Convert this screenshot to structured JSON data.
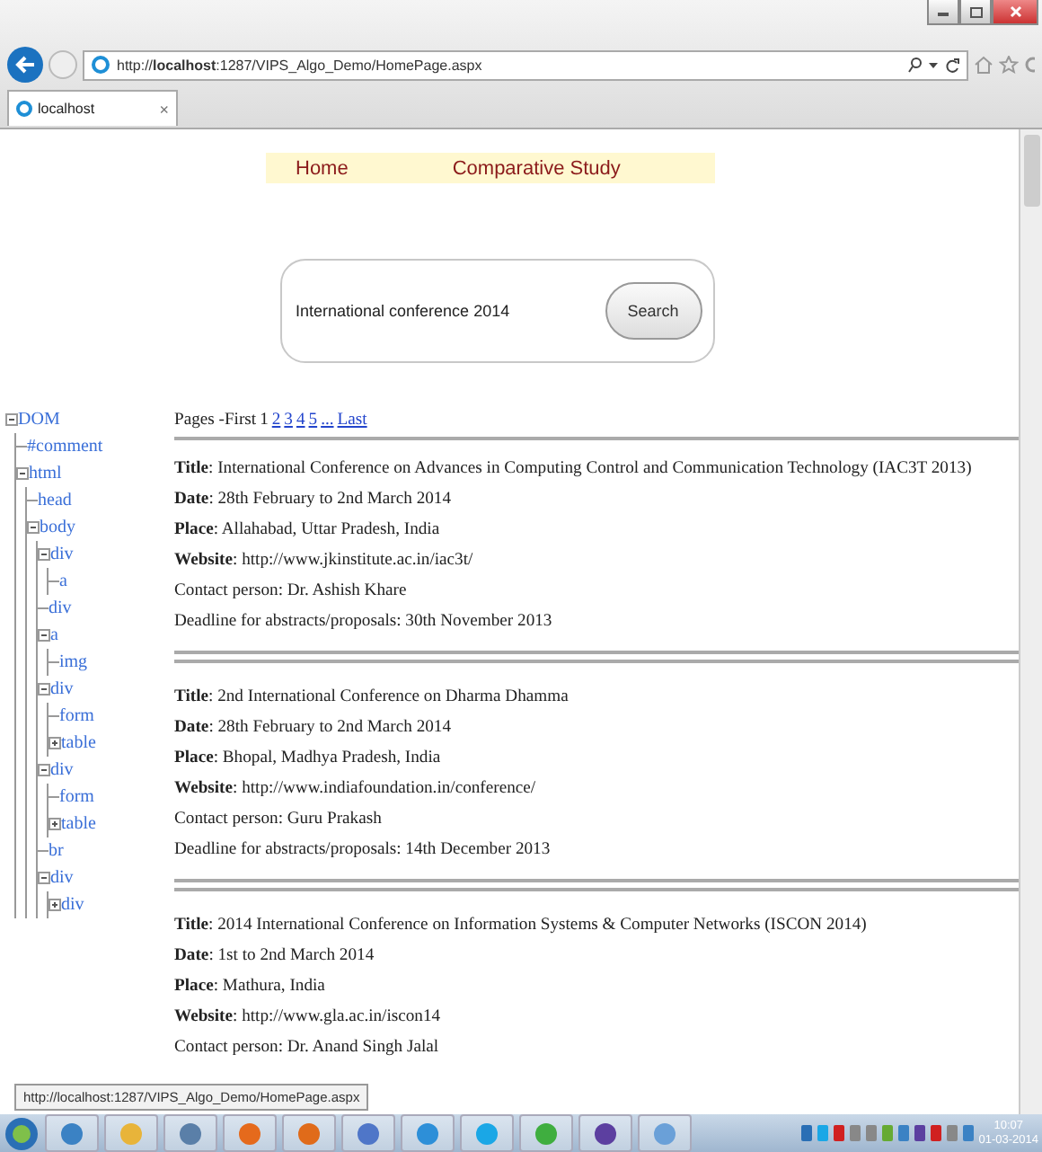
{
  "browser": {
    "address": "http://**localhost**:1287/VIPS_Algo_Demo/HomePage.aspx",
    "tabs": [
      {
        "label": "localhost",
        "selected": true,
        "close": "×"
      }
    ]
  },
  "nav": [
    {
      "label": "Home"
    },
    {
      "label": "Comparative Study"
    }
  ],
  "search": {
    "value": "International conference 2014",
    "button": "Search"
  },
  "tree": [
    {
      "label": "DOM",
      "expanded": true,
      "children": [
        {
          "label": "#comment"
        },
        {
          "label": "html",
          "expanded": true,
          "children": [
            {
              "label": "head"
            },
            {
              "label": "body",
              "expanded": true,
              "children": [
                {
                  "label": "div",
                  "expanded": true,
                  "children": [
                    {
                      "label": "a"
                    }
                  ]
                },
                {
                  "label": "div"
                },
                {
                  "label": "a",
                  "expanded": true,
                  "children": [
                    {
                      "label": "img"
                    }
                  ]
                },
                {
                  "label": "div",
                  "expanded": true,
                  "children": [
                    {
                      "label": "form"
                    },
                    {
                      "label": "table",
                      "expanded": false
                    }
                  ]
                },
                {
                  "label": "div",
                  "expanded": true,
                  "children": [
                    {
                      "label": "form"
                    },
                    {
                      "label": "table",
                      "expanded": false
                    }
                  ]
                },
                {
                  "label": "br"
                },
                {
                  "label": "div",
                  "expanded": true,
                  "children": [
                    {
                      "label": "div",
                      "expanded": false
                    }
                  ]
                }
              ]
            }
          ]
        }
      ]
    }
  ],
  "pager": {
    "prefix": "Pages -First",
    "pages": [
      {
        "label": "1",
        "selected": true
      },
      {
        "label": "2",
        "selected": false
      },
      {
        "label": "3",
        "selected": false
      },
      {
        "label": "4",
        "selected": false
      },
      {
        "label": "5",
        "selected": false
      }
    ],
    "more": "...",
    "last": "Last"
  },
  "results": [
    {
      "lines": [
        "**Title**: International Conference on Advances in Computing Control and Communication Technology (IAC3T 2013)",
        "**Date**: 28th February to 2nd March 2014",
        "**Place**: Allahabad, Uttar Pradesh, India",
        "**Website**: http://www.jkinstitute.ac.in/iac3t/",
        "Contact person: Dr. Ashish Khare",
        "Deadline for abstracts/proposals: 30th November 2013"
      ]
    },
    {
      "lines": [
        "**Title**: 2nd International Conference on Dharma Dhamma",
        "**Date**: 28th February to 2nd March 2014",
        "**Place**: Bhopal, Madhya Pradesh, India",
        "**Website**: http://www.indiafoundation.in/conference/",
        "Contact person: Guru Prakash",
        "Deadline for abstracts/proposals: 14th December 2013"
      ]
    },
    {
      "lines": [
        "**Title**: 2014 International Conference on Information Systems & Computer Networks (ISCON 2014)",
        "**Date**: 1st to 2nd March 2014",
        "**Place**: Mathura, India",
        "**Website**: http://www.gla.ac.in/iscon14",
        "Contact person: Dr. Anand Singh Jalal"
      ]
    }
  ],
  "status_url": "http://localhost:1287/VIPS_Algo_Demo/HomePage.aspx",
  "clock": {
    "time": "10:07",
    "date": "01-03-2014"
  }
}
